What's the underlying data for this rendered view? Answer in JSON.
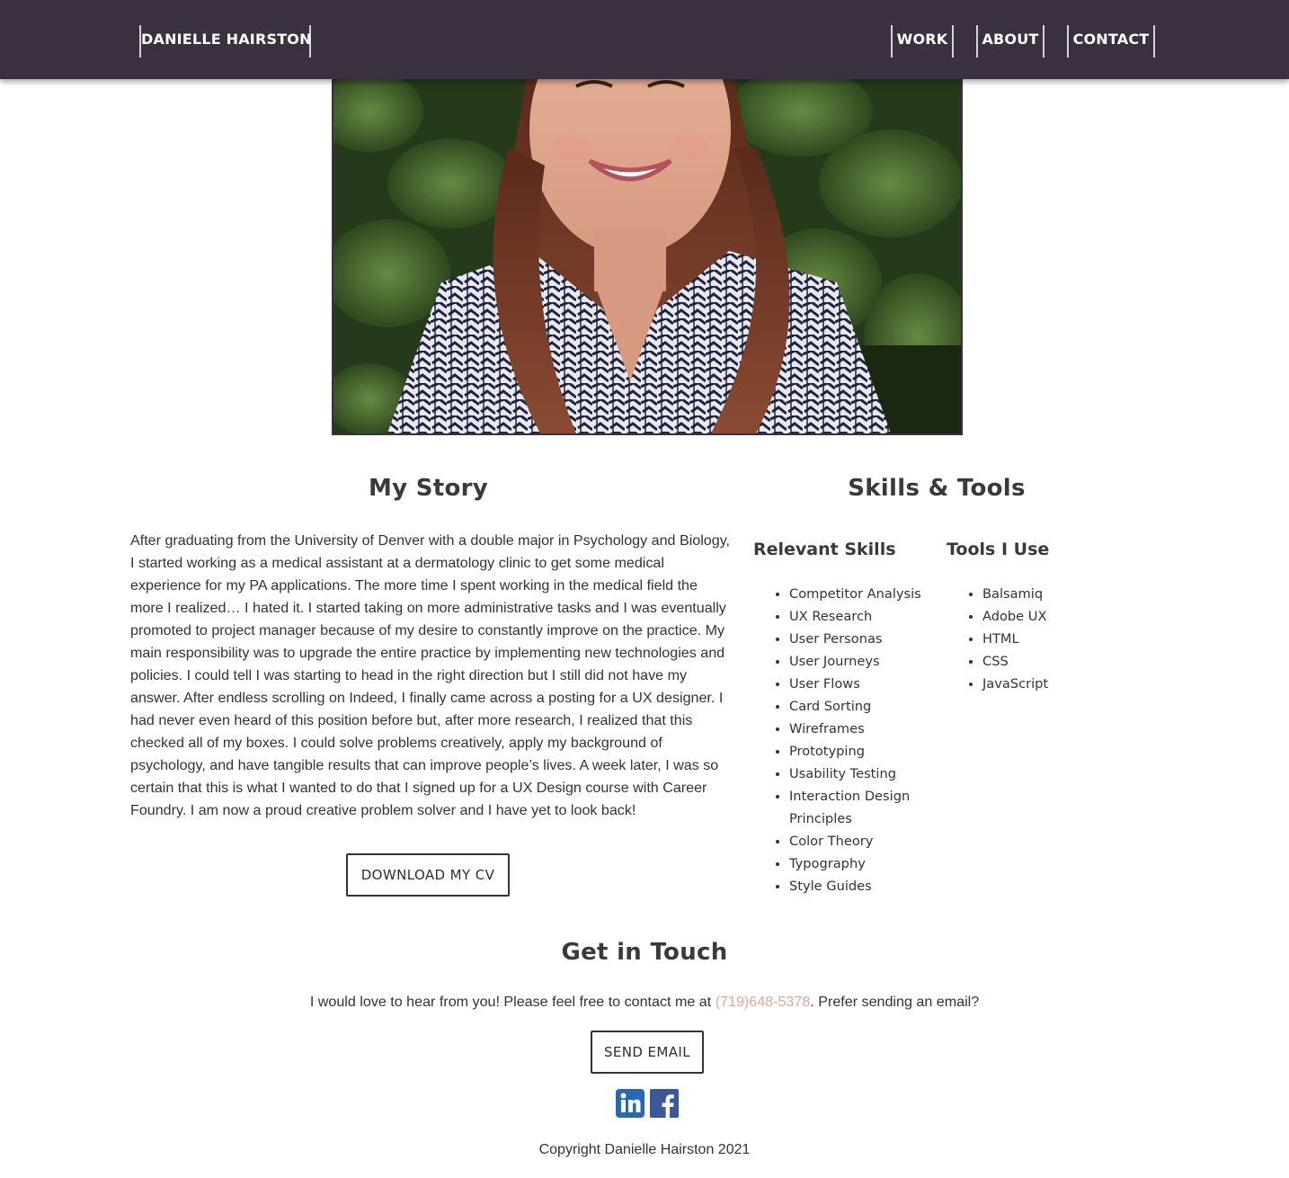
{
  "header": {
    "brand": "DANIELLE HAIRSTON",
    "nav": {
      "work": "WORK",
      "about": "ABOUT",
      "contact": "CONTACT"
    }
  },
  "story": {
    "heading": "My Story",
    "body": "After graduating from the University of Denver with a double major in Psychology and Biology, I started working as a medical assistant at a dermatology clinic to get some medical experience for my PA applications. The more time I spent working in the medical field the more I realized… I hated it. I started taking on more administrative tasks and I was eventually promoted to project manager because of my desire to constantly improve on the practice. My main responsibility was to upgrade the entire practice by implementing new technologies and policies. I could tell I was starting to head in the right direction but I still did not have my answer. After endless scrolling on Indeed, I finally came across a posting for a UX designer. I had never even heard of this position before but, after more research, I realized that this checked all of my boxes. I could solve problems creatively, apply my background of psychology, and have tangible results that can improve people’s lives. A week later, I was so certain that this is what I wanted to do that I signed up for a UX Design course with Career Foundry. I am now a proud creative problem solver and I have yet to look back!",
    "cv_button": "DOWNLOAD MY CV"
  },
  "skills": {
    "heading": "Skills & Tools",
    "relevant_heading": "Relevant Skills",
    "relevant": [
      "Competitor Analysis",
      "UX Research",
      "User Personas",
      "User Journeys",
      "User Flows",
      "Card Sorting",
      "Wireframes",
      "Prototyping",
      "Usability Testing",
      "Interaction Design Principles",
      "Color Theory",
      "Typography",
      "Style Guides"
    ],
    "tools_heading": "Tools I Use",
    "tools": [
      "Balsamiq",
      "Adobe UX",
      "HTML",
      "CSS",
      "JavaScript"
    ]
  },
  "contact": {
    "heading": "Get in Touch",
    "text_before": "I would love to hear from you! Please feel free to contact me at ",
    "phone": "(719)648-5378",
    "text_after": ". Prefer sending an email?",
    "email_button": "SEND EMAIL",
    "social_icons": [
      "linkedin-icon",
      "facebook-icon"
    ]
  },
  "footer": {
    "copyright": "Copyright Danielle Hairston 2021"
  },
  "colors": {
    "header_bg": "#3b3040",
    "accent_link": "#e3a79b",
    "linkedin": "#2867b2",
    "facebook": "#3b5998"
  }
}
